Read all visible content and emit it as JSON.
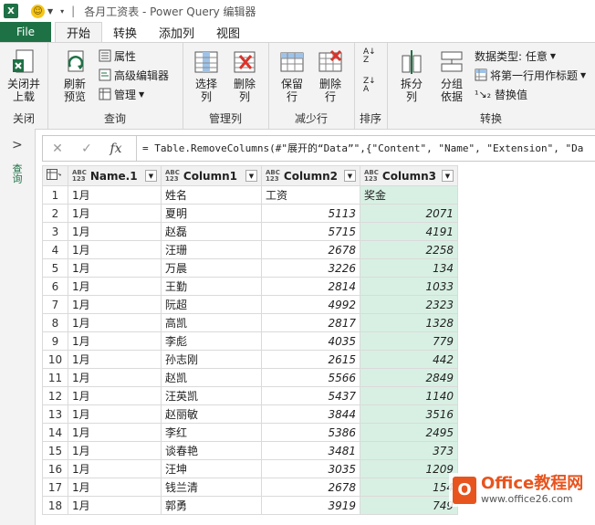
{
  "window": {
    "title": "各月工资表 - Power Query 编辑器",
    "app_icon": "X"
  },
  "tabs": {
    "file": "File",
    "items": [
      "开始",
      "转换",
      "添加列",
      "视图"
    ]
  },
  "ribbon": {
    "close_group": {
      "btn": "关闭并\n上载",
      "label": "关闭"
    },
    "query_group": {
      "refresh": "刷新\n预览",
      "props": "属性",
      "adv_editor": "高级编辑器",
      "manage": "管理",
      "label": "查询"
    },
    "manage_cols": {
      "choose": "选择\n列",
      "remove": "删除\n列",
      "label": "管理列"
    },
    "reduce_rows": {
      "keep": "保留\n行",
      "remove": "删除\n行",
      "label": "减少行"
    },
    "sort": {
      "label": "排序"
    },
    "transform": {
      "split": "拆分\n列",
      "group": "分组\n依据",
      "dtype": "数据类型: 任意",
      "first_row": "将第一行用作标题",
      "replace": "替换值",
      "label": "转换"
    }
  },
  "side": {
    "label": "查询"
  },
  "formula": {
    "text": "= Table.RemoveColumns(#\"展开的“Data”\",{\"Content\", \"Name\", \"Extension\", \"Da"
  },
  "table": {
    "headers": [
      "Name.1",
      "Column1",
      "Column2",
      "Column3"
    ],
    "rows": [
      [
        "1",
        "1月",
        "姓名",
        "工资",
        "奖金"
      ],
      [
        "2",
        "1月",
        "夏明",
        "5113",
        "2071"
      ],
      [
        "3",
        "1月",
        "赵磊",
        "5715",
        "4191"
      ],
      [
        "4",
        "1月",
        "汪珊",
        "2678",
        "2258"
      ],
      [
        "5",
        "1月",
        "万晨",
        "3226",
        "134"
      ],
      [
        "6",
        "1月",
        "王勤",
        "2814",
        "1033"
      ],
      [
        "7",
        "1月",
        "阮超",
        "4992",
        "2323"
      ],
      [
        "8",
        "1月",
        "高凯",
        "2817",
        "1328"
      ],
      [
        "9",
        "1月",
        "李彪",
        "4035",
        "779"
      ],
      [
        "10",
        "1月",
        "孙志刚",
        "2615",
        "442"
      ],
      [
        "11",
        "1月",
        "赵凯",
        "5566",
        "2849"
      ],
      [
        "12",
        "1月",
        "汪英凯",
        "5437",
        "1140"
      ],
      [
        "13",
        "1月",
        "赵丽敏",
        "3844",
        "3516"
      ],
      [
        "14",
        "1月",
        "李红",
        "5386",
        "2495"
      ],
      [
        "15",
        "1月",
        "谈春艳",
        "3481",
        "373"
      ],
      [
        "16",
        "1月",
        "汪坤",
        "3035",
        "1209"
      ],
      [
        "17",
        "1月",
        "钱兰清",
        "2678",
        "154"
      ],
      [
        "18",
        "1月",
        "郭勇",
        "3919",
        "749"
      ]
    ]
  },
  "watermark": {
    "brand": "Office教程网",
    "url": "www.office26.com"
  }
}
